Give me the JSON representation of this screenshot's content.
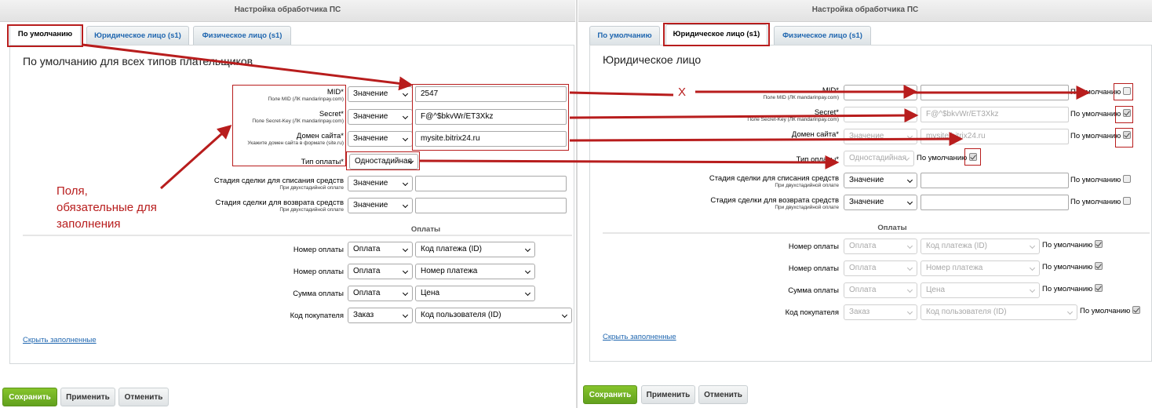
{
  "window_title": "Настройка обработчика ПС",
  "tabs": [
    "По умолчанию",
    "Юридическое лицо (s1)",
    "Физическое лицо (s1)"
  ],
  "left": {
    "heading": "По умолчанию для всех типов плательщиков",
    "fields": [
      {
        "label": "MID*",
        "hint": "Поле MID (ЛК mandarinpay.com)",
        "source": "Значение",
        "value": "2547"
      },
      {
        "label": "Secret*",
        "hint": "Поле Secret-Key (ЛК mandarinpay.com)",
        "source": "Значение",
        "value": "F@^$bkvWr/ET3Xkz"
      },
      {
        "label": "Домен сайта*",
        "hint": "Укажите домен сайта в формате (site.ru)",
        "source": "Значение",
        "value": "mysite.bitrix24.ru"
      },
      {
        "label": "Тип оплаты*",
        "hint": "",
        "source": "Одностадийная",
        "value": ""
      },
      {
        "label": "Стадия сделки для списания средств",
        "hint": "При двухстадийной оплате",
        "source": "Значение",
        "value": ""
      },
      {
        "label": "Стадия сделки для возврата средств",
        "hint": "При двухстадийной оплате",
        "source": "Значение",
        "value": ""
      }
    ],
    "payments_title": "Оплаты",
    "payments": [
      {
        "label": "Номер оплаты",
        "source": "Оплата",
        "value": "Код платежа (ID)"
      },
      {
        "label": "Номер оплаты",
        "source": "Оплата",
        "value": "Номер платежа"
      },
      {
        "label": "Сумма оплаты",
        "source": "Оплата",
        "value": "Цена"
      },
      {
        "label": "Код покупателя",
        "source": "Заказ",
        "value": "Код пользователя (ID)"
      }
    ],
    "hide_link": "Скрыть заполненные"
  },
  "right": {
    "heading": "Юридическое лицо",
    "fields": [
      {
        "label": "MID*",
        "hint": "Поле MID (ЛК mandarinpay.com)",
        "source": "",
        "value": "",
        "default_checked": false
      },
      {
        "label": "Secret*",
        "hint": "Поле Secret-Key (ЛК mandarinpay.com)",
        "source": "",
        "value": "F@^$bkvWr/ET3Xkz",
        "default_checked": true
      },
      {
        "label": "Домен сайта*",
        "hint": "",
        "source": "Значение",
        "value": "mysite.bitrix24.ru",
        "default_checked": true
      },
      {
        "label": "Тип оплаты*",
        "hint": "",
        "source": "Одностадийная",
        "value": "",
        "default_checked": true
      },
      {
        "label": "Стадия сделки для списания средств",
        "hint": "При двухстадийной оплате",
        "source": "Значение",
        "value": "",
        "default_checked": false
      },
      {
        "label": "Стадия сделки для возврата средств",
        "hint": "При двухстадийной оплате",
        "source": "Значение",
        "value": "",
        "default_checked": false
      }
    ],
    "payments_title": "Оплаты",
    "payments": [
      {
        "label": "Номер оплаты",
        "source": "Оплата",
        "value": "Код платежа (ID)",
        "default_checked": true
      },
      {
        "label": "Номер оплаты",
        "source": "Оплата",
        "value": "Номер платежа",
        "default_checked": true
      },
      {
        "label": "Сумма оплаты",
        "source": "Оплата",
        "value": "Цена",
        "default_checked": true
      },
      {
        "label": "Код покупателя",
        "source": "Заказ",
        "value": "Код пользователя (ID)",
        "default_checked": true
      }
    ],
    "hide_link": "Скрыть заполненные"
  },
  "default_label": "По умолчанию",
  "buttons": {
    "save": "Сохранить",
    "apply": "Применить",
    "cancel": "Отменить"
  },
  "annotations": {
    "required_note": "Поля, обязательные для заполнения",
    "x_mark": "X"
  },
  "colors": {
    "annotation_red": "#b81d1d",
    "link_blue": "#2067b0",
    "save_green": "#6aaa20"
  }
}
